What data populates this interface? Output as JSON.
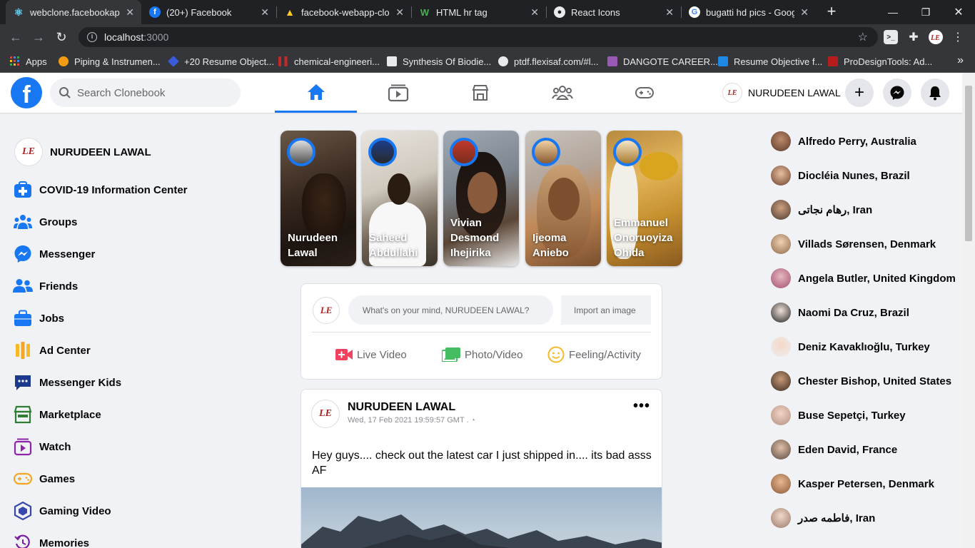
{
  "browser": {
    "tabs": [
      {
        "title": "webclone.facebookapp",
        "active": true,
        "icon": "react-icon"
      },
      {
        "title": "(20+) Facebook",
        "active": false,
        "icon": "facebook-icon"
      },
      {
        "title": "facebook-webapp-clon",
        "active": false,
        "icon": "firebase-icon"
      },
      {
        "title": "HTML hr tag",
        "active": false,
        "icon": "w3-icon"
      },
      {
        "title": "React Icons",
        "active": false,
        "icon": "react-icons-icon"
      },
      {
        "title": "bugatti hd pics - Googl",
        "active": false,
        "icon": "google-icon"
      }
    ],
    "url_host": "localhost",
    "url_port": ":3000",
    "bookmarks": [
      {
        "label": "Apps"
      },
      {
        "label": "Piping & Instrumen..."
      },
      {
        "label": "+20 Resume Object..."
      },
      {
        "label": "chemical-engineeri..."
      },
      {
        "label": "Synthesis Of Biodie..."
      },
      {
        "label": "ptdf.flexisaf.com/#l..."
      },
      {
        "label": "DANGOTE CAREER..."
      },
      {
        "label": "Resume Objective f..."
      },
      {
        "label": "ProDesignTools: Ad..."
      }
    ]
  },
  "header": {
    "logo": "f",
    "search_placeholder": "Search Clonebook",
    "user_name": "NURUDEEN LAWAL",
    "plus": "+",
    "accent": "#1877f2"
  },
  "sidebar": {
    "user_name": "NURUDEEN LAWAL",
    "items": [
      {
        "label": "COVID-19 Information Center",
        "icon": "covid-info-icon"
      },
      {
        "label": "Groups",
        "icon": "groups-icon"
      },
      {
        "label": "Messenger",
        "icon": "messenger-icon"
      },
      {
        "label": "Friends",
        "icon": "friends-icon"
      },
      {
        "label": "Jobs",
        "icon": "jobs-icon"
      },
      {
        "label": "Ad Center",
        "icon": "ad-center-icon"
      },
      {
        "label": "Messenger Kids",
        "icon": "messenger-kids-icon"
      },
      {
        "label": "Marketplace",
        "icon": "marketplace-icon"
      },
      {
        "label": "Watch",
        "icon": "watch-icon"
      },
      {
        "label": "Games",
        "icon": "games-icon"
      },
      {
        "label": "Gaming Video",
        "icon": "gaming-video-icon"
      },
      {
        "label": "Memories",
        "icon": "memories-icon"
      }
    ]
  },
  "stories": [
    {
      "name": "Nurudeen Lawal"
    },
    {
      "name": "Saheed Abdullahi"
    },
    {
      "name": "Vivian Desmond Ihejirika"
    },
    {
      "name": "Ijeoma Aniebo"
    },
    {
      "name": "Emmanuel Onoruoyiza Ohida"
    }
  ],
  "composer": {
    "placeholder": "What's on your mind, NURUDEEN LAWAL?",
    "image_placeholder": "Import an image",
    "actions": [
      {
        "label": "Live Video",
        "icon": "live-video-icon",
        "color": "#f3425f"
      },
      {
        "label": "Photo/Video",
        "icon": "photo-video-icon",
        "color": "#45bd62"
      },
      {
        "label": "Feeling/Activity",
        "icon": "feeling-icon",
        "color": "#f7b928"
      }
    ]
  },
  "post": {
    "author": "NURUDEEN LAWAL",
    "timestamp": "Wed, 17 Feb 2021 19:59:57 GMT .",
    "text": "Hey guys.... check out the latest car I just shipped in.... its bad asss AF",
    "more": "•••"
  },
  "contacts": [
    {
      "name": "Alfredo Perry, Australia"
    },
    {
      "name": "Diocléia Nunes, Brazil"
    },
    {
      "name": "رهام نجاتی, Iran"
    },
    {
      "name": "Villads Sørensen, Denmark"
    },
    {
      "name": "Angela Butler, United Kingdom"
    },
    {
      "name": "Naomi Da Cruz, Brazil"
    },
    {
      "name": "Deniz Kavaklıoğlu, Turkey"
    },
    {
      "name": "Chester Bishop, United States"
    },
    {
      "name": "Buse Sepetçi, Turkey"
    },
    {
      "name": "Eden David, France"
    },
    {
      "name": "Kasper Petersen, Denmark"
    },
    {
      "name": "فاطمه صدر, Iran"
    }
  ]
}
